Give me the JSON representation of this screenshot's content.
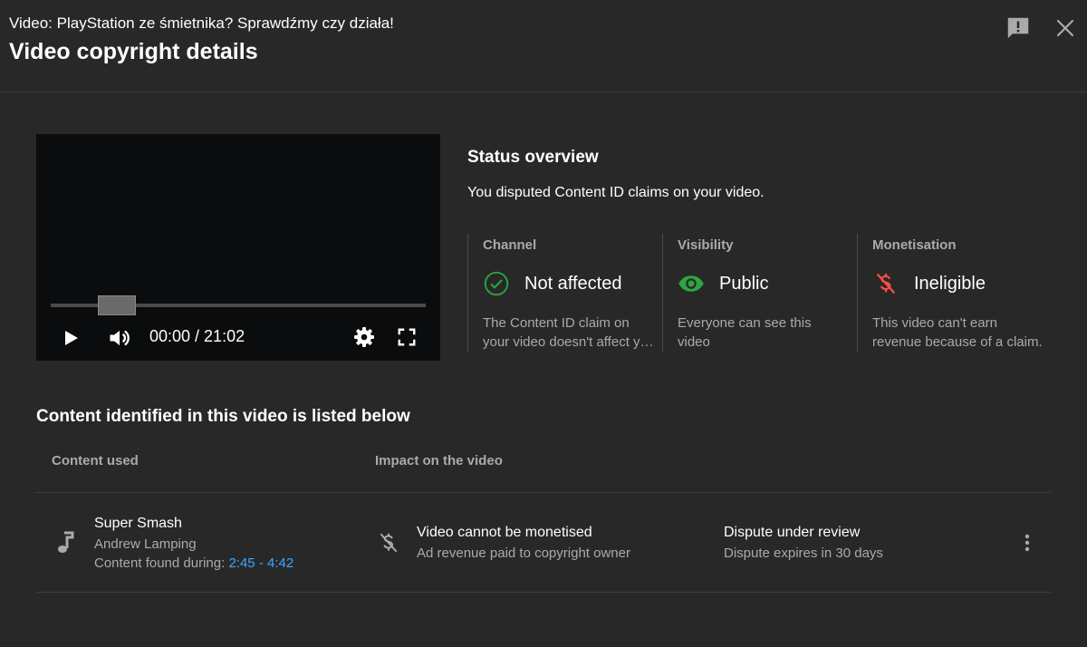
{
  "header": {
    "video_title": "Video: PlayStation ze śmietnika? Sprawdźmy czy działa!",
    "dialog_title": "Video copyright details",
    "feedback_icon": "feedback-icon",
    "close_icon": "close-icon"
  },
  "player": {
    "time": "00:00 / 21:02",
    "progress": 0,
    "icons": [
      "play-icon",
      "volume-icon",
      "settings-icon",
      "fullscreen-icon"
    ]
  },
  "status": {
    "heading": "Status overview",
    "text": "You disputed Content ID claims on your video.",
    "columns": [
      {
        "label": "Channel",
        "value": "Not affected",
        "icon": "check-circle-icon",
        "icon_color": "#2ba640",
        "desc_line1": "The Content ID claim on",
        "desc_line2": "your video doesn't affect your channel."
      },
      {
        "label": "Visibility",
        "value": "Public",
        "icon": "eye-icon",
        "icon_color": "#2ba640",
        "desc_line1": "Everyone can see this",
        "desc_line2": "video"
      },
      {
        "label": "Monetisation",
        "value": "Ineligible",
        "icon": "no-money-icon",
        "icon_color": "#ff4e45",
        "desc_line1": "This video can't earn",
        "desc_line2": "revenue because of a claim."
      }
    ]
  },
  "content": {
    "section_title": "Content identified in this video is listed below",
    "col_content": "Content used",
    "col_impact": "Impact on the video",
    "rows": [
      {
        "title": "Super Smash",
        "artist": "Andrew Lamping",
        "found_label": "Content found during:",
        "found_range": "2:45 - 4:42",
        "impact_title": "Video cannot be monetised",
        "impact_sub": "Ad revenue paid to copyright owner",
        "dispute_title": "Dispute under review",
        "dispute_sub": "Dispute expires in 30 days"
      }
    ]
  },
  "colors": {
    "background": "#282828",
    "secondary_text": "#aaaaaa",
    "link": "#3ea6ff",
    "success": "#2ba640",
    "error": "#ff4e45"
  }
}
